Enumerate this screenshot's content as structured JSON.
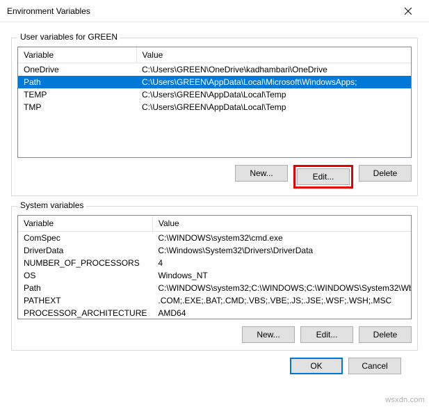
{
  "window": {
    "title": "Environment Variables"
  },
  "user_section": {
    "label": "User variables for GREEN",
    "columns": {
      "var": "Variable",
      "val": "Value"
    },
    "rows": [
      {
        "var": "OneDrive",
        "val": "C:\\Users\\GREEN\\OneDrive\\kadhambari\\OneDrive"
      },
      {
        "var": "Path",
        "val": "C:\\Users\\GREEN\\AppData\\Local\\Microsoft\\WindowsApps;"
      },
      {
        "var": "TEMP",
        "val": "C:\\Users\\GREEN\\AppData\\Local\\Temp"
      },
      {
        "var": "TMP",
        "val": "C:\\Users\\GREEN\\AppData\\Local\\Temp"
      }
    ],
    "selected_index": 1,
    "buttons": {
      "new": "New...",
      "edit": "Edit...",
      "delete": "Delete"
    }
  },
  "system_section": {
    "label": "System variables",
    "columns": {
      "var": "Variable",
      "val": "Value"
    },
    "rows": [
      {
        "var": "ComSpec",
        "val": "C:\\WINDOWS\\system32\\cmd.exe"
      },
      {
        "var": "DriverData",
        "val": "C:\\Windows\\System32\\Drivers\\DriverData"
      },
      {
        "var": "NUMBER_OF_PROCESSORS",
        "val": "4"
      },
      {
        "var": "OS",
        "val": "Windows_NT"
      },
      {
        "var": "Path",
        "val": "C:\\WINDOWS\\system32;C:\\WINDOWS;C:\\WINDOWS\\System32\\Wb..."
      },
      {
        "var": "PATHEXT",
        "val": ".COM;.EXE;.BAT;.CMD;.VBS;.VBE;.JS;.JSE;.WSF;.WSH;.MSC"
      },
      {
        "var": "PROCESSOR_ARCHITECTURE",
        "val": "AMD64"
      }
    ],
    "buttons": {
      "new": "New...",
      "edit": "Edit...",
      "delete": "Delete"
    }
  },
  "dialog_buttons": {
    "ok": "OK",
    "cancel": "Cancel"
  },
  "watermark": "wsxdn.com"
}
